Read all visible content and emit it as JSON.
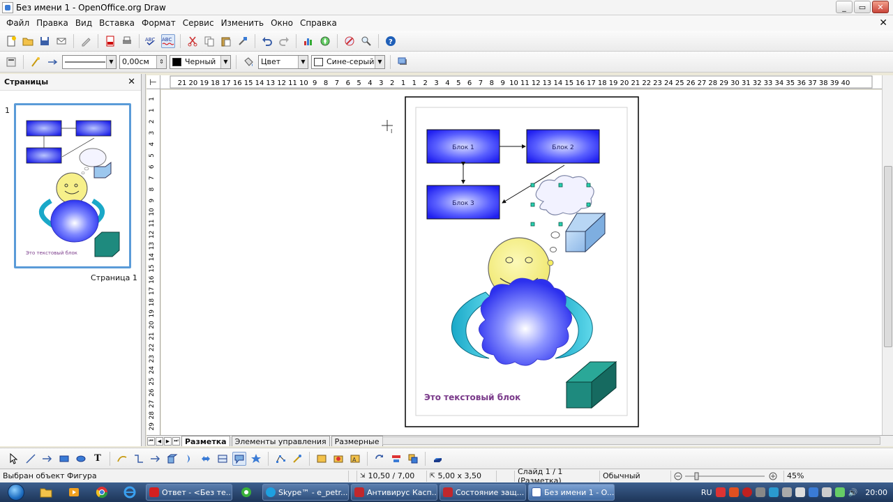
{
  "window": {
    "title": "Без имени 1 - OpenOffice.org Draw",
    "min_label": "_",
    "max_label": "▭",
    "close_label": "✕"
  },
  "menu": [
    "Файл",
    "Правка",
    "Вид",
    "Вставка",
    "Формат",
    "Сервис",
    "Изменить",
    "Окно",
    "Справка"
  ],
  "menu_close": "✕",
  "toolbar2": {
    "line_width": "0,00см",
    "line_color": "Черный",
    "area_style": "Цвет",
    "area_color": "Сине-серый"
  },
  "pages_panel": {
    "title": "Страницы",
    "close": "✕",
    "page_number": "1",
    "page_label": "Страница 1",
    "thumb_text": "Это текстовый блок"
  },
  "hruler_labels": [
    "21",
    "20",
    "19",
    "18",
    "17",
    "16",
    "15",
    "14",
    "13",
    "12",
    "11",
    "10",
    "9",
    "8",
    "7",
    "6",
    "5",
    "4",
    "3",
    "2",
    "1",
    "1",
    "2",
    "3",
    "4",
    "5",
    "6",
    "7",
    "8",
    "9",
    "10",
    "11",
    "12",
    "13",
    "14",
    "15",
    "16",
    "17",
    "18",
    "19",
    "20",
    "21",
    "22",
    "23",
    "24",
    "25",
    "26",
    "27",
    "28",
    "29",
    "30",
    "31",
    "32",
    "33",
    "34",
    "35",
    "36",
    "37",
    "38",
    "39",
    "40"
  ],
  "vruler_labels": [
    "1",
    "1",
    "2",
    "3",
    "4",
    "5",
    "6",
    "7",
    "8",
    "9",
    "10",
    "11",
    "12",
    "13",
    "14",
    "15",
    "16",
    "17",
    "18",
    "19",
    "20",
    "21",
    "22",
    "23",
    "24",
    "25",
    "26",
    "27",
    "28",
    "29"
  ],
  "diagram": {
    "block1": "Блок 1",
    "block2": "Блок 2",
    "block3": "Блок 3",
    "text_block": "Это текстовый блок",
    "colors": {
      "block": "#2a2aff",
      "smiley": "#f7f08a",
      "cloud": "#5a66ff",
      "arc": "#1aa8c8",
      "box_teal": "#1e8a7e",
      "box_light": "#9cc7ee",
      "text": "#7a3a8a"
    }
  },
  "tabs": [
    "Разметка",
    "Элементы управления",
    "Размерные"
  ],
  "statusbar": {
    "message": "Выбран объект Фигура",
    "position": "10,50 / 7,00",
    "size": "5,00 x 3,50",
    "slide": "Слайд 1 / 1 (Разметка)",
    "layout": "Обычный",
    "zoom": "45%"
  },
  "taskbar": {
    "tasks": [
      {
        "label": "Ответ - <Без те...",
        "color": "#d32020"
      },
      {
        "label": "Skype™ - e_petr...",
        "color": "#1ea0e0"
      },
      {
        "label": "Антивирус Касп...",
        "color": "#c0282d"
      },
      {
        "label": "Состояние защ...",
        "color": "#c0282d"
      },
      {
        "label": "Без имени 1 - O...",
        "color": "#4a7fc0"
      }
    ],
    "lang": "RU",
    "clock": "20:00"
  }
}
